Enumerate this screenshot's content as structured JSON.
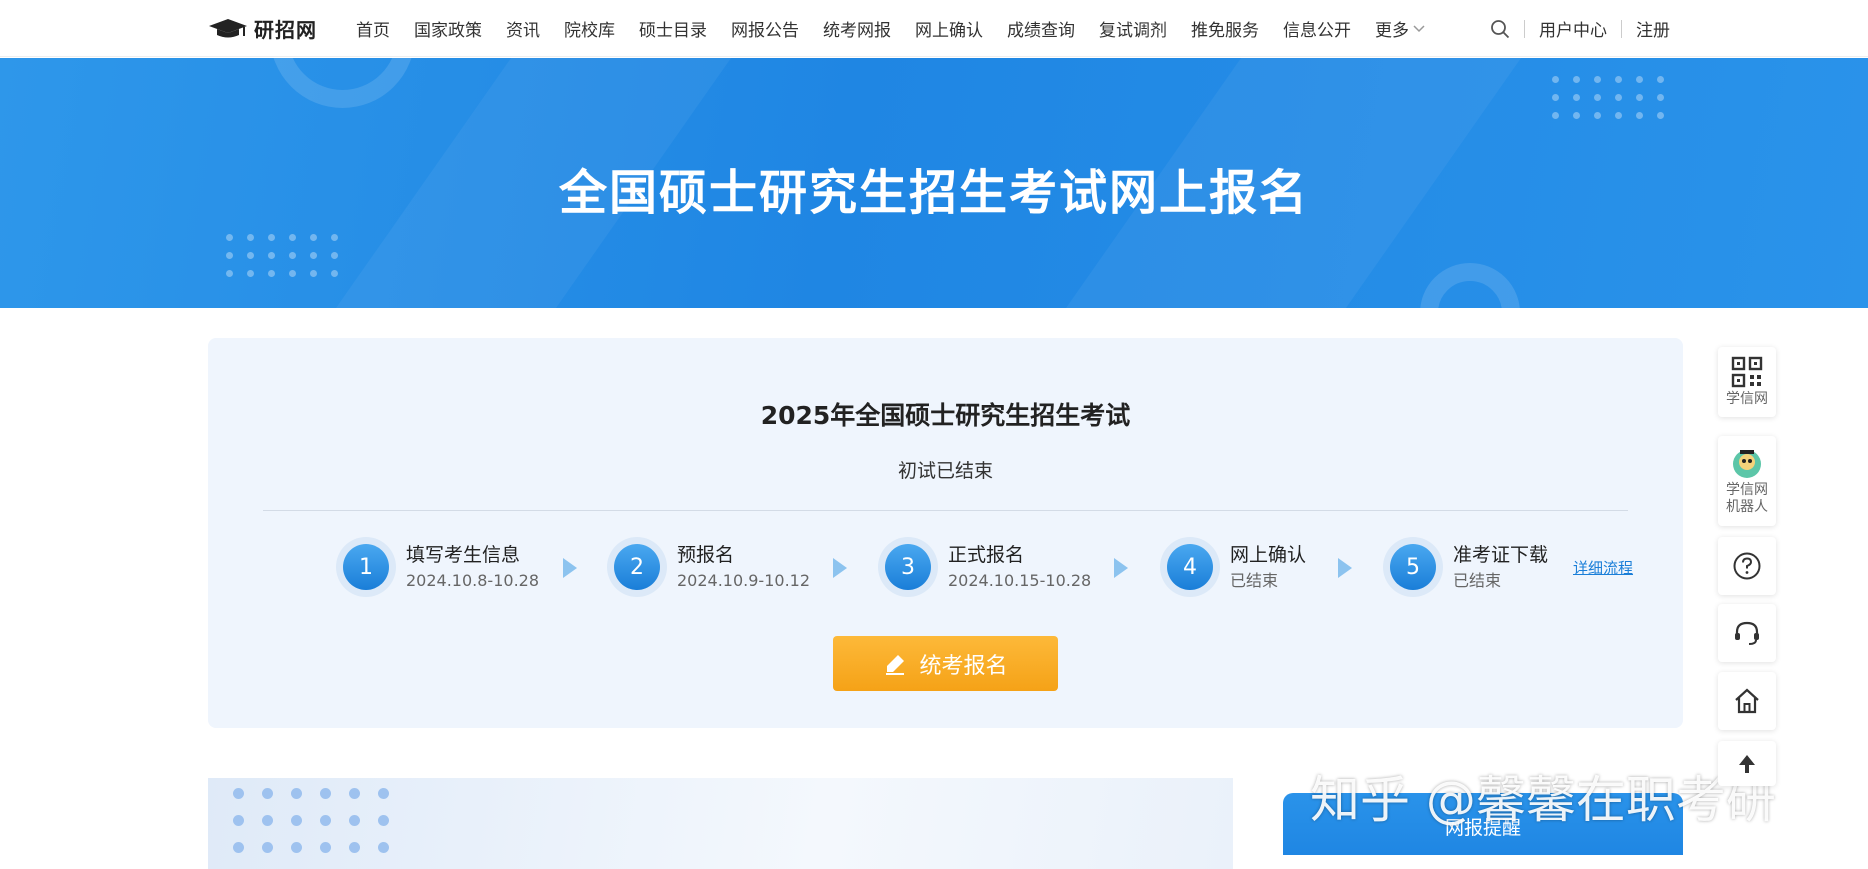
{
  "nav": {
    "logo_text": "研招网",
    "items": [
      "首页",
      "国家政策",
      "资讯",
      "院校库",
      "硕士目录",
      "网报公告",
      "统考网报",
      "网上确认",
      "成绩查询",
      "复试调剂",
      "推免服务",
      "信息公开"
    ],
    "more_label": "更多",
    "user_center": "用户中心",
    "register": "注册"
  },
  "banner": {
    "title": "全国硕士研究生招生考试网上报名"
  },
  "exam": {
    "title": "2025年全国硕士研究生招生考试",
    "status": "初试已结束",
    "steps": [
      {
        "num": "1",
        "title": "填写考生信息",
        "date": "2024.10.8-10.28"
      },
      {
        "num": "2",
        "title": "预报名",
        "date": "2024.10.9-10.12"
      },
      {
        "num": "3",
        "title": "正式报名",
        "date": "2024.10.15-10.28"
      },
      {
        "num": "4",
        "title": "网上确认",
        "date": "已结束"
      },
      {
        "num": "5",
        "title": "准考证下载",
        "date": "已结束"
      }
    ],
    "detail_link": "详细流程",
    "signup_button": "统考报名"
  },
  "sidebar": {
    "xuexin_label": "学信网",
    "robot_label_1": "学信网",
    "robot_label_2": "机器人"
  },
  "reminder": {
    "title": "网报提醒"
  },
  "watermark": "知乎 @馨馨在职考研",
  "colors": {
    "primary_blue": "#1f86e3",
    "button_orange": "#f5a217",
    "card_bg": "#eff5fd"
  }
}
